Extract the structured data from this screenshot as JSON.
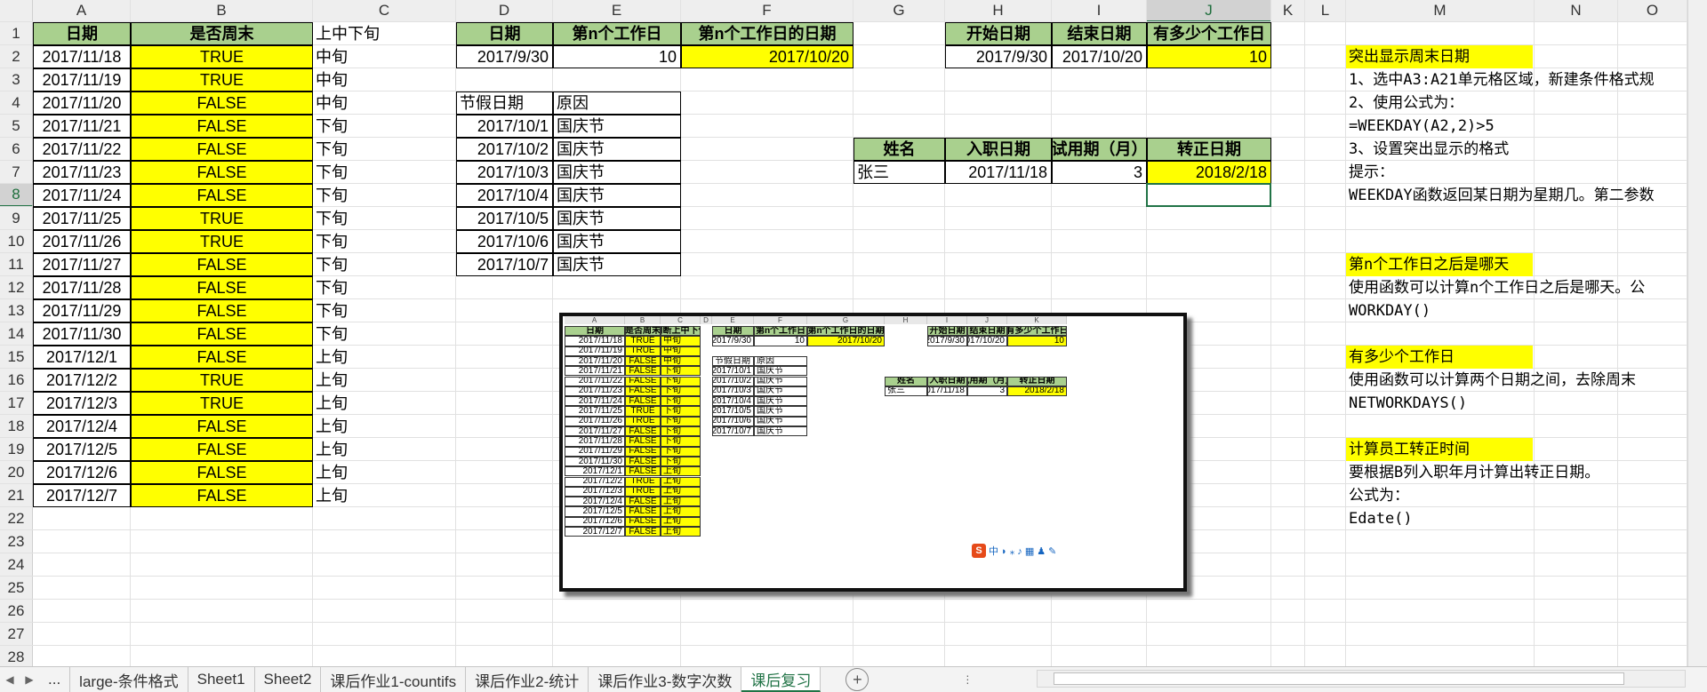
{
  "column_headers": [
    "A",
    "B",
    "C",
    "D",
    "E",
    "F",
    "G",
    "H",
    "I",
    "J",
    "K",
    "L",
    "M",
    "N",
    "O"
  ],
  "row_headers": [
    "1",
    "2",
    "3",
    "4",
    "5",
    "6",
    "7",
    "8",
    "9",
    "10",
    "11",
    "12",
    "13",
    "14",
    "15",
    "16",
    "17",
    "18",
    "19",
    "20",
    "21",
    "22",
    "23",
    "24",
    "25",
    "26",
    "27",
    "28"
  ],
  "table_weekend": {
    "headers": [
      "日期",
      "是否周末",
      "上中下旬"
    ],
    "rows": [
      [
        "2017/11/18",
        "TRUE",
        "中旬"
      ],
      [
        "2017/11/19",
        "TRUE",
        "中旬"
      ],
      [
        "2017/11/20",
        "FALSE",
        "中旬"
      ],
      [
        "2017/11/21",
        "FALSE",
        "下旬"
      ],
      [
        "2017/11/22",
        "FALSE",
        "下旬"
      ],
      [
        "2017/11/23",
        "FALSE",
        "下旬"
      ],
      [
        "2017/11/24",
        "FALSE",
        "下旬"
      ],
      [
        "2017/11/25",
        "TRUE",
        "下旬"
      ],
      [
        "2017/11/26",
        "TRUE",
        "下旬"
      ],
      [
        "2017/11/27",
        "FALSE",
        "下旬"
      ],
      [
        "2017/11/28",
        "FALSE",
        "下旬"
      ],
      [
        "2017/11/29",
        "FALSE",
        "下旬"
      ],
      [
        "2017/11/30",
        "FALSE",
        "下旬"
      ],
      [
        "2017/12/1",
        "FALSE",
        "上旬"
      ],
      [
        "2017/12/2",
        "TRUE",
        "上旬"
      ],
      [
        "2017/12/3",
        "TRUE",
        "上旬"
      ],
      [
        "2017/12/4",
        "FALSE",
        "上旬"
      ],
      [
        "2017/12/5",
        "FALSE",
        "上旬"
      ],
      [
        "2017/12/6",
        "FALSE",
        "上旬"
      ],
      [
        "2017/12/7",
        "FALSE",
        "上旬"
      ]
    ]
  },
  "table_workday": {
    "headers": [
      "日期",
      "第n个工作日",
      "第n个工作日的日期"
    ],
    "row": [
      "2017/9/30",
      "10",
      "2017/10/20"
    ]
  },
  "table_holiday": {
    "headers": [
      "节假日期",
      "原因"
    ],
    "rows": [
      [
        "2017/10/1",
        "国庆节"
      ],
      [
        "2017/10/2",
        "国庆节"
      ],
      [
        "2017/10/3",
        "国庆节"
      ],
      [
        "2017/10/4",
        "国庆节"
      ],
      [
        "2017/10/5",
        "国庆节"
      ],
      [
        "2017/10/6",
        "国庆节"
      ],
      [
        "2017/10/7",
        "国庆节"
      ]
    ]
  },
  "table_networkdays": {
    "headers": [
      "开始日期",
      "结束日期",
      "有多少个工作日"
    ],
    "row": [
      "2017/9/30",
      "2017/10/20",
      "10"
    ]
  },
  "table_employee": {
    "headers": [
      "姓名",
      "入职日期",
      "试用期（月）",
      "转正日期"
    ],
    "row": [
      "张三",
      "2017/11/18",
      "3",
      "2018/2/18"
    ]
  },
  "notes": {
    "n1_title": "突出显示周末日期",
    "n1_l1": "1、选中A3:A21单元格区域，新建条件格式规",
    "n1_l2": "2、使用公式为：",
    "n1_l3": "=WEEKDAY(A2,2)>5",
    "n1_l4": "3、设置突出显示的格式",
    "n1_l5": "提示：",
    "n1_l6": "WEEKDAY函数返回某日期为星期几。第二参数",
    "n2_title": "第n个工作日之后是哪天",
    "n2_l1": "使用函数可以计算n个工作日之后是哪天。公",
    "n2_l2": "WORKDAY()",
    "n3_title": "有多少个工作日",
    "n3_l1": "使用函数可以计算两个日期之间，去除周末",
    "n3_l2": "NETWORKDAYS()",
    "n4_title": "计算员工转正时间",
    "n4_l1": "要根据B列入职年月计算出转正日期。",
    "n4_l2": "公式为：",
    "n4_l3": "Edate()"
  },
  "thumbnail": {
    "col_headers": [
      "A",
      "B",
      "C",
      "D",
      "E",
      "F",
      "G",
      "H",
      "I",
      "J",
      "K"
    ],
    "weekend_headers": [
      "日期",
      "是否周末",
      "判断上中下旬"
    ],
    "ime_label": "中"
  },
  "sheet_tabs": [
    "...",
    "large-条件格式",
    "Sheet1",
    "Sheet2",
    "课后作业1-countifs",
    "课后作业2-统计",
    "课后作业3-数字次数",
    "课后复习"
  ],
  "active_tab": "课后复习",
  "colors": {
    "header_green": "#a9d08e",
    "highlight_yellow": "#ffff00",
    "accent": "#217346"
  }
}
